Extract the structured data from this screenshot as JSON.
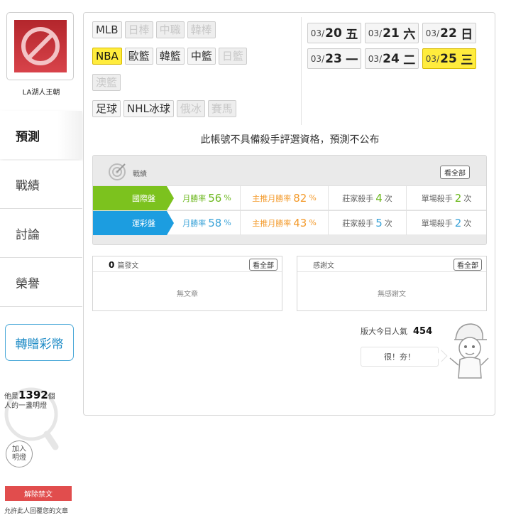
{
  "sidebar": {
    "user_name": "LA湖人王朝",
    "tabs": [
      {
        "label": "預測",
        "active": true
      },
      {
        "label": "戰績",
        "active": false
      },
      {
        "label": "討論",
        "active": false
      },
      {
        "label": "榮譽",
        "active": false
      }
    ],
    "gift_label": "轉贈彩幣",
    "bulb_prefix": "他是",
    "bulb_count": "1392",
    "bulb_unit": "個",
    "bulb_suffix": "人的一盞明燈",
    "light_button": "加入明燈",
    "unblock_label": "解除禁文",
    "unblock_note": "允許此人回覆您的文章"
  },
  "sports": {
    "row1": [
      {
        "label": "MLB",
        "state": "normal"
      },
      {
        "label": "日棒",
        "state": "disabled"
      },
      {
        "label": "中職",
        "state": "disabled"
      },
      {
        "label": "韓棒",
        "state": "disabled"
      }
    ],
    "row2": [
      {
        "label": "NBA",
        "state": "active"
      },
      {
        "label": "歐籃",
        "state": "normal"
      },
      {
        "label": "韓籃",
        "state": "normal"
      },
      {
        "label": "中籃",
        "state": "normal"
      },
      {
        "label": "日籃",
        "state": "disabled"
      }
    ],
    "row3": [
      {
        "label": "澳籃",
        "state": "disabled"
      }
    ],
    "row4": [
      {
        "label": "足球",
        "state": "normal"
      },
      {
        "label": "NHL冰球",
        "state": "normal"
      },
      {
        "label": "俄冰",
        "state": "disabled"
      },
      {
        "label": "賽馬",
        "state": "disabled"
      }
    ]
  },
  "dates": [
    {
      "md": "03/",
      "day": "20",
      "wd": "五",
      "active": false
    },
    {
      "md": "03/",
      "day": "21",
      "wd": "六",
      "active": false
    },
    {
      "md": "03/",
      "day": "22",
      "wd": "日",
      "active": false
    },
    {
      "md": "03/",
      "day": "23",
      "wd": "一",
      "active": false
    },
    {
      "md": "03/",
      "day": "24",
      "wd": "二",
      "active": false
    },
    {
      "md": "03/",
      "day": "25",
      "wd": "三",
      "active": true
    }
  ],
  "notice": "此帳號不具備殺手評選資格，預測不公布",
  "record": {
    "title": "戰績",
    "view_all": "看全部",
    "rows": [
      {
        "label": "國際盤",
        "color": "#7cc21e",
        "win_label": "月勝率",
        "win": "56",
        "main_label": "主推月勝率",
        "main": "82",
        "banker_label": "莊家殺手",
        "banker": "4",
        "single_label": "單場殺手",
        "single": "2",
        "times": "次",
        "pct": "%"
      },
      {
        "label": "運彩盤",
        "color": "#1c9de0",
        "win_label": "月勝率",
        "win": "58",
        "main_label": "主推月勝率",
        "main": "43",
        "banker_label": "莊家殺手",
        "banker": "5",
        "single_label": "單場殺手",
        "single": "2",
        "times": "次",
        "pct": "%"
      }
    ]
  },
  "articles": {
    "count": "0",
    "title": "篇發文",
    "view_all": "看全部",
    "empty": "無文章"
  },
  "thanks": {
    "title": "感謝文",
    "view_all": "看全部",
    "empty": "無感謝文"
  },
  "popularity": {
    "label": "版大今日人氣",
    "value": "454",
    "cheer": "很！夯！"
  }
}
